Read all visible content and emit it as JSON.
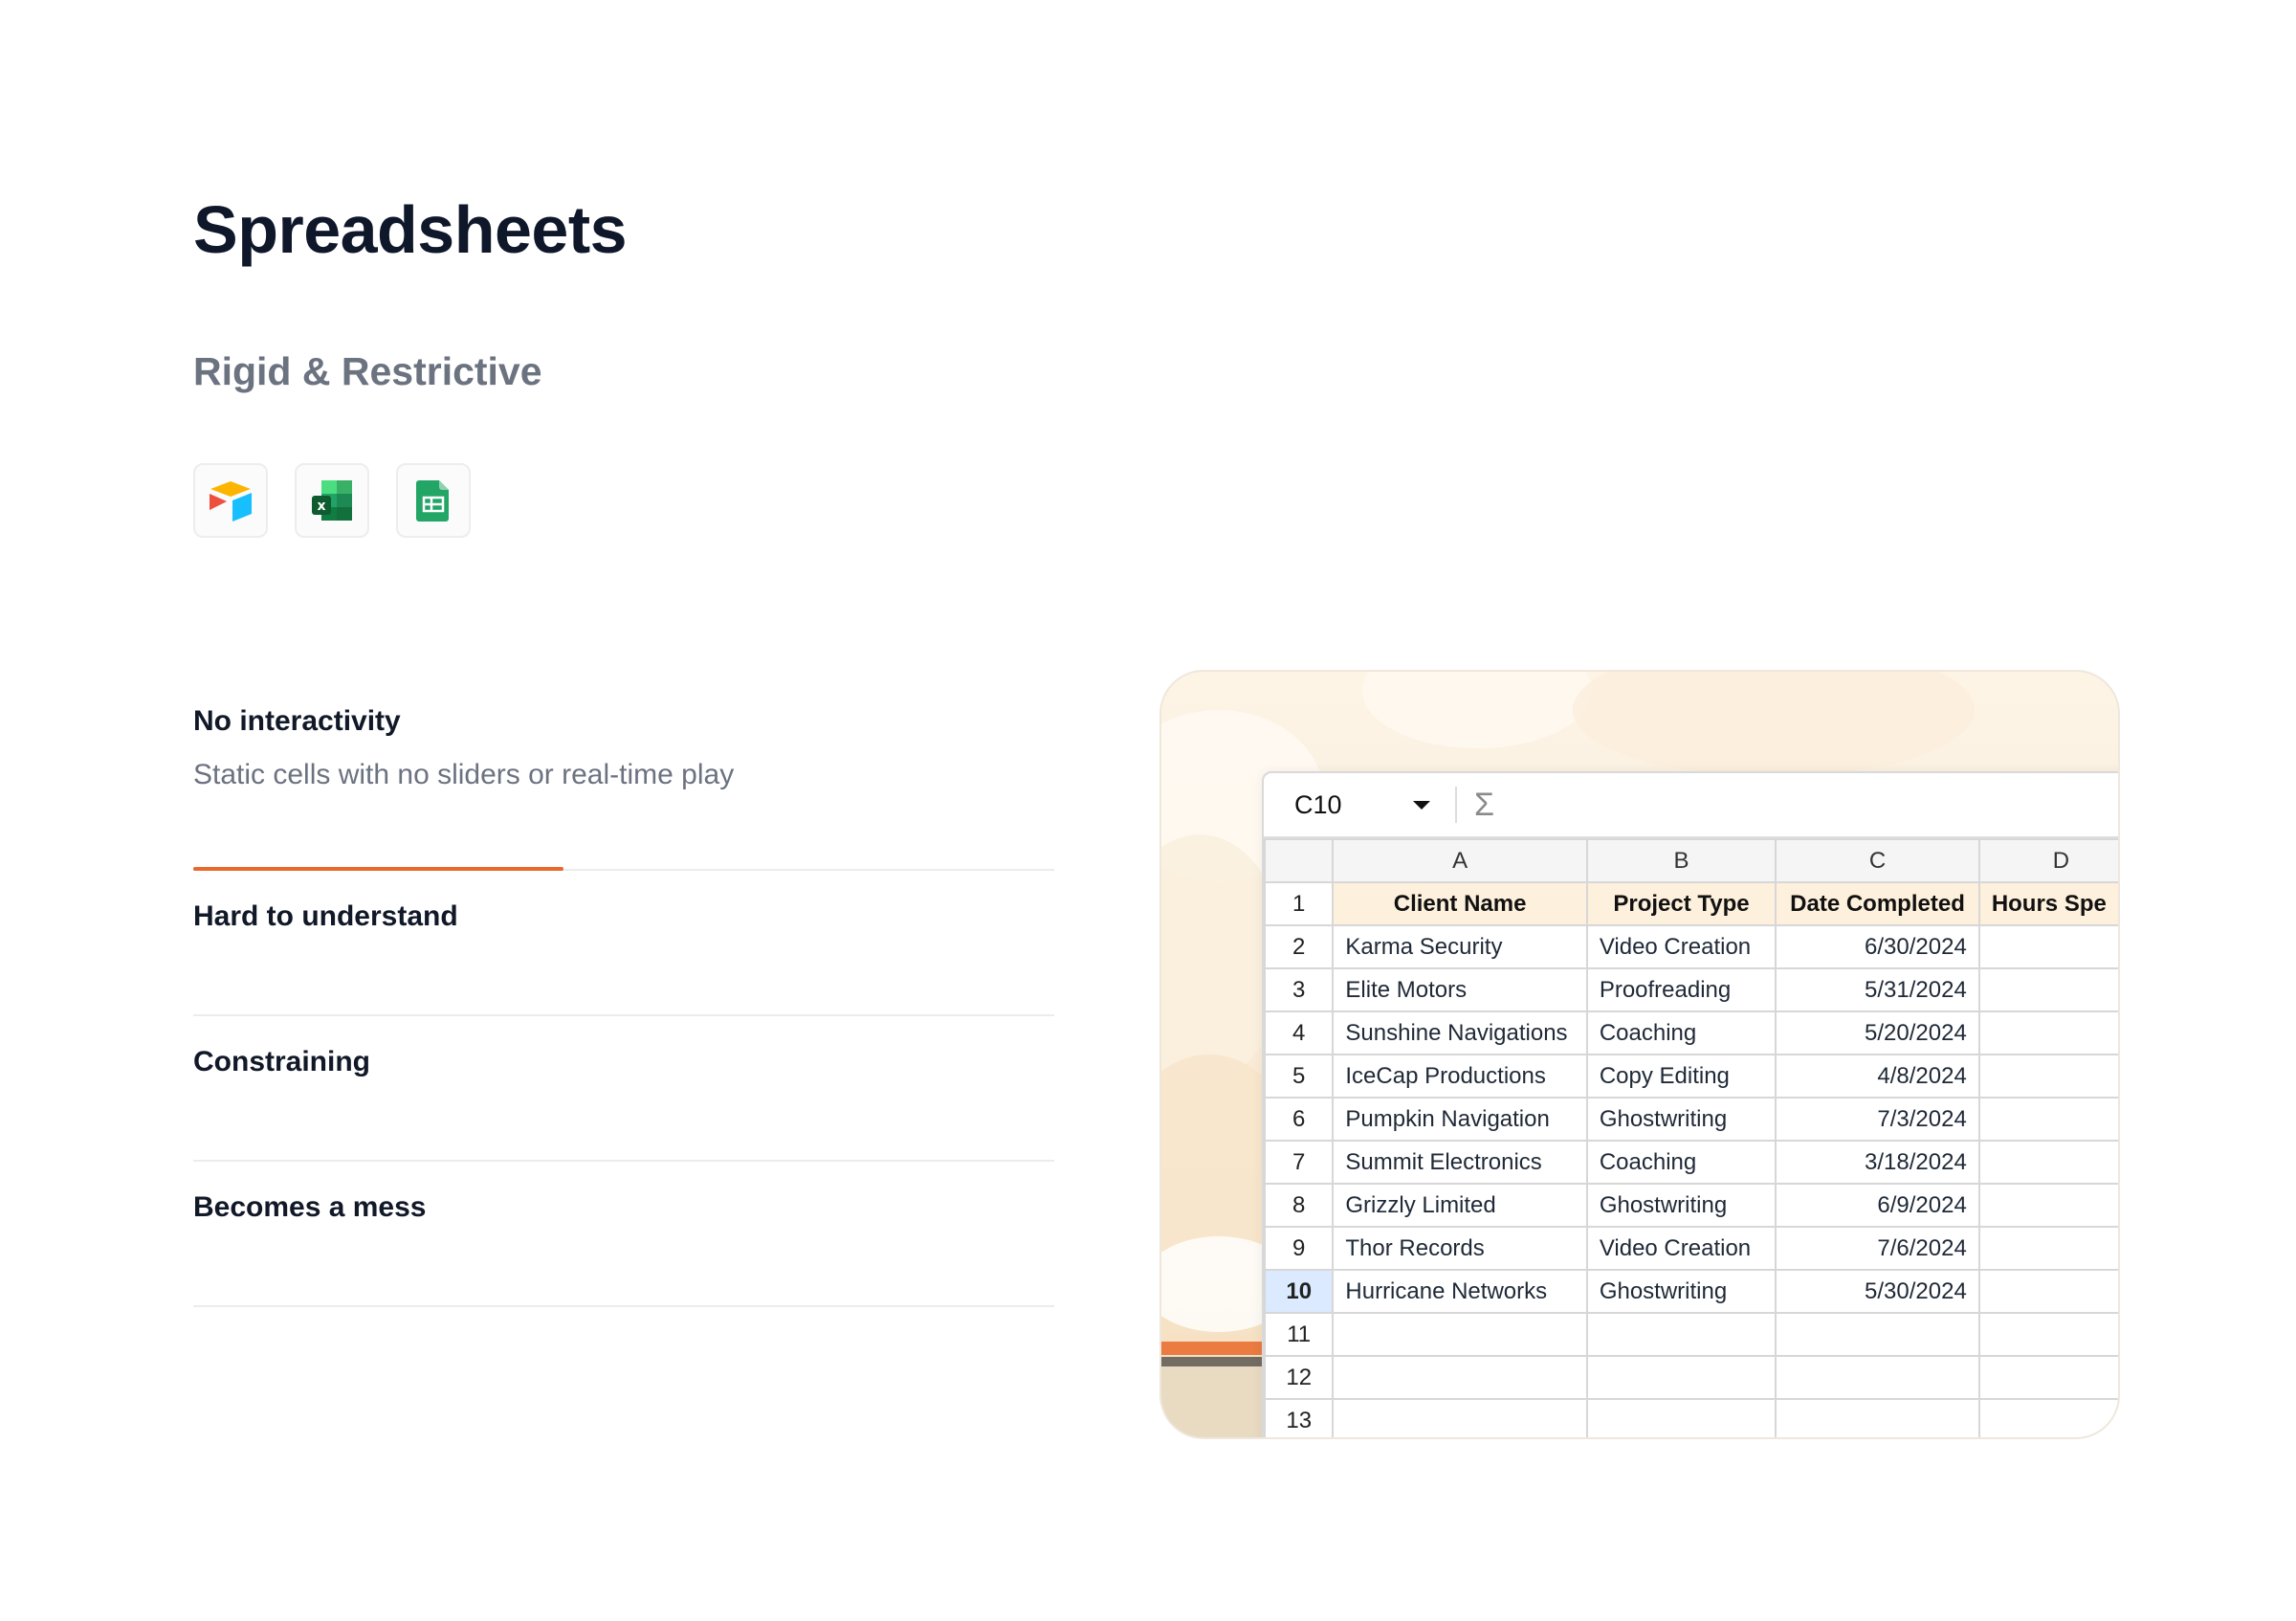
{
  "page": {
    "title": "Spreadsheets",
    "subtitle": "Rigid & Restrictive"
  },
  "apps": [
    {
      "name": "Airtable",
      "icon": "airtable-icon"
    },
    {
      "name": "Microsoft Excel",
      "icon": "excel-icon"
    },
    {
      "name": "Google Sheets",
      "icon": "google-sheets-icon"
    }
  ],
  "features": [
    {
      "title": "No interactivity",
      "description": "Static cells with no sliders or real-time play",
      "active": true,
      "progress": 0.43
    },
    {
      "title": "Hard to understand"
    },
    {
      "title": "Constraining"
    },
    {
      "title": "Becomes a mess"
    }
  ],
  "colors": {
    "accent": "#e8692a",
    "header_fill": "#fdf0dc",
    "selected_row": "#dbeafe"
  },
  "spreadsheet": {
    "cell_ref": "C10",
    "formula_icon": "Σ",
    "columns": [
      "A",
      "B",
      "C",
      "D"
    ],
    "header": [
      "Client Name",
      "Project Type",
      "Date Completed",
      "Hours Spe"
    ],
    "rows": [
      [
        "Karma Security",
        "Video Creation",
        "6/30/2024",
        ""
      ],
      [
        "Elite Motors",
        "Proofreading",
        "5/31/2024",
        ""
      ],
      [
        "Sunshine Navigations",
        "Coaching",
        "5/20/2024",
        ""
      ],
      [
        "IceCap Productions",
        "Copy Editing",
        "4/8/2024",
        ""
      ],
      [
        "Pumpkin Navigation",
        "Ghostwriting",
        "7/3/2024",
        ""
      ],
      [
        "Summit Electronics",
        "Coaching",
        "3/18/2024",
        ""
      ],
      [
        "Grizzly Limited",
        "Ghostwriting",
        "6/9/2024",
        ""
      ],
      [
        "Thor Records",
        "Video Creation",
        "7/6/2024",
        ""
      ],
      [
        "Hurricane Networks",
        "Ghostwriting",
        "5/30/2024",
        ""
      ],
      [
        "",
        "",
        "",
        ""
      ],
      [
        "",
        "",
        "",
        ""
      ],
      [
        "",
        "",
        "",
        ""
      ]
    ],
    "row_numbers": [
      "1",
      "2",
      "3",
      "4",
      "5",
      "6",
      "7",
      "8",
      "9",
      "10",
      "11",
      "12",
      "13"
    ],
    "selected_row": "10"
  }
}
